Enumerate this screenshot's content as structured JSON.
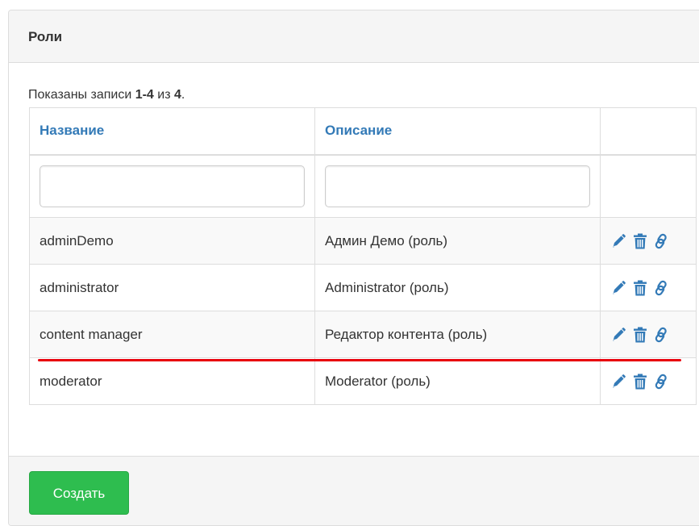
{
  "panel": {
    "title": "Роли"
  },
  "summary": {
    "prefix": "Показаны записи ",
    "range": "1-4",
    "middle": " из ",
    "total": "4",
    "suffix": "."
  },
  "table": {
    "columns": [
      "Название",
      "Описание",
      ""
    ],
    "filters": {
      "name_value": "",
      "description_value": ""
    },
    "rows": [
      {
        "name": "adminDemo",
        "description": "Админ Демо (роль)"
      },
      {
        "name": "administrator",
        "description": "Administrator (роль)"
      },
      {
        "name": "content manager",
        "description": "Редактор контента (роль)"
      },
      {
        "name": "moderator",
        "description": "Moderator (роль)"
      }
    ],
    "action_icons": [
      "pencil-icon",
      "trash-icon",
      "link-icon"
    ]
  },
  "annotation": {
    "underline_row": "content manager",
    "color": "#e8000d"
  },
  "footer": {
    "create_label": "Создать"
  },
  "colors": {
    "link": "#337ab7",
    "create_button": "#2ebd4f"
  }
}
